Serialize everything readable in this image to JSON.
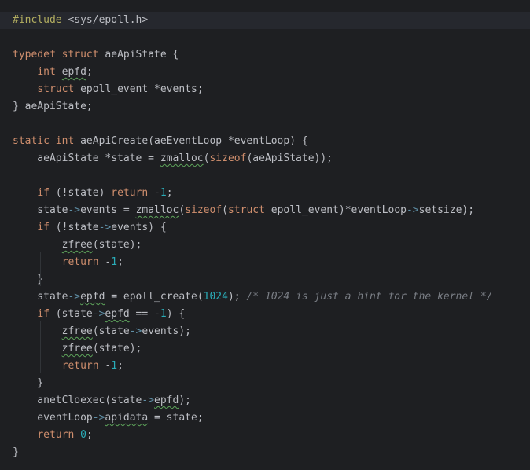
{
  "editor": {
    "current_line_index": 0,
    "lines": [
      [
        {
          "t": "#include",
          "c": "pp"
        },
        {
          "t": " <sys/epoll.h>",
          "c": ""
        }
      ],
      [],
      [
        {
          "t": "typedef",
          "c": "kw"
        },
        {
          "t": " ",
          "c": ""
        },
        {
          "t": "struct",
          "c": "kw"
        },
        {
          "t": " aeApiState {",
          "c": ""
        }
      ],
      [
        {
          "t": "    ",
          "c": ""
        },
        {
          "t": "int",
          "c": "kw"
        },
        {
          "t": " ",
          "c": ""
        },
        {
          "t": "epfd",
          "c": "squig"
        },
        {
          "t": ";",
          "c": ""
        }
      ],
      [
        {
          "t": "    ",
          "c": ""
        },
        {
          "t": "struct",
          "c": "kw"
        },
        {
          "t": " epoll_event *events;",
          "c": ""
        }
      ],
      [
        {
          "t": "} aeApiState;",
          "c": ""
        }
      ],
      [],
      [
        {
          "t": "static",
          "c": "kw"
        },
        {
          "t": " ",
          "c": ""
        },
        {
          "t": "int",
          "c": "kw"
        },
        {
          "t": " aeApiCreate(aeEventLoop *eventLoop) {",
          "c": ""
        }
      ],
      [
        {
          "t": "    aeApiState *state = ",
          "c": ""
        },
        {
          "t": "zmalloc",
          "c": "squig"
        },
        {
          "t": "(",
          "c": ""
        },
        {
          "t": "sizeof",
          "c": "kw"
        },
        {
          "t": "(aeApiState));",
          "c": ""
        }
      ],
      [],
      [
        {
          "t": "    ",
          "c": ""
        },
        {
          "t": "if",
          "c": "kw"
        },
        {
          "t": " (!state) ",
          "c": ""
        },
        {
          "t": "return",
          "c": "kw"
        },
        {
          "t": " -",
          "c": ""
        },
        {
          "t": "1",
          "c": "num"
        },
        {
          "t": ";",
          "c": ""
        }
      ],
      [
        {
          "t": "    state",
          "c": ""
        },
        {
          "t": "->",
          "c": "ar"
        },
        {
          "t": "events = ",
          "c": ""
        },
        {
          "t": "zmalloc",
          "c": "squig"
        },
        {
          "t": "(",
          "c": ""
        },
        {
          "t": "sizeof",
          "c": "kw"
        },
        {
          "t": "(",
          "c": ""
        },
        {
          "t": "struct",
          "c": "kw"
        },
        {
          "t": " epoll_event)*eventLoop",
          "c": ""
        },
        {
          "t": "->",
          "c": "ar"
        },
        {
          "t": "setsize);",
          "c": ""
        }
      ],
      [
        {
          "t": "    ",
          "c": ""
        },
        {
          "t": "if",
          "c": "kw"
        },
        {
          "t": " (!state",
          "c": ""
        },
        {
          "t": "->",
          "c": "ar"
        },
        {
          "t": "events) {",
          "c": ""
        }
      ],
      [
        {
          "t": "        ",
          "c": ""
        },
        {
          "t": "zfree",
          "c": "squig"
        },
        {
          "t": "(state);",
          "c": ""
        }
      ],
      [
        {
          "t": "        ",
          "c": ""
        },
        {
          "t": "return",
          "c": "kw"
        },
        {
          "t": " -",
          "c": ""
        },
        {
          "t": "1",
          "c": "num"
        },
        {
          "t": ";",
          "c": ""
        }
      ],
      [
        {
          "t": "    }",
          "c": ""
        }
      ],
      [
        {
          "t": "    state",
          "c": ""
        },
        {
          "t": "->",
          "c": "ar"
        },
        {
          "t": "epfd",
          "c": "squig"
        },
        {
          "t": " = epoll_create(",
          "c": ""
        },
        {
          "t": "1024",
          "c": "num"
        },
        {
          "t": "); ",
          "c": ""
        },
        {
          "t": "/* 1024 is just a hint for the kernel */",
          "c": "cm"
        }
      ],
      [
        {
          "t": "    ",
          "c": ""
        },
        {
          "t": "if",
          "c": "kw"
        },
        {
          "t": " (state",
          "c": ""
        },
        {
          "t": "->",
          "c": "ar"
        },
        {
          "t": "epfd",
          "c": "squig"
        },
        {
          "t": " == -",
          "c": ""
        },
        {
          "t": "1",
          "c": "num"
        },
        {
          "t": ") {",
          "c": ""
        }
      ],
      [
        {
          "t": "        ",
          "c": ""
        },
        {
          "t": "zfree",
          "c": "squig"
        },
        {
          "t": "(state",
          "c": ""
        },
        {
          "t": "->",
          "c": "ar"
        },
        {
          "t": "events);",
          "c": ""
        }
      ],
      [
        {
          "t": "        ",
          "c": ""
        },
        {
          "t": "zfree",
          "c": "squig"
        },
        {
          "t": "(state);",
          "c": ""
        }
      ],
      [
        {
          "t": "        ",
          "c": ""
        },
        {
          "t": "return",
          "c": "kw"
        },
        {
          "t": " -",
          "c": ""
        },
        {
          "t": "1",
          "c": "num"
        },
        {
          "t": ";",
          "c": ""
        }
      ],
      [
        {
          "t": "    }",
          "c": ""
        }
      ],
      [
        {
          "t": "    anetCloexec(state",
          "c": ""
        },
        {
          "t": "->",
          "c": "ar"
        },
        {
          "t": "epfd",
          "c": "squig"
        },
        {
          "t": ");",
          "c": ""
        }
      ],
      [
        {
          "t": "    eventLoop",
          "c": ""
        },
        {
          "t": "->",
          "c": "ar"
        },
        {
          "t": "apidata",
          "c": "squig"
        },
        {
          "t": " = state;",
          "c": ""
        }
      ],
      [
        {
          "t": "    ",
          "c": ""
        },
        {
          "t": "return",
          "c": "kw"
        },
        {
          "t": " ",
          "c": ""
        },
        {
          "t": "0",
          "c": "num"
        },
        {
          "t": ";",
          "c": ""
        }
      ],
      [
        {
          "t": "}",
          "c": ""
        }
      ]
    ]
  },
  "colors": {
    "background": "#1e1f22",
    "current_line": "#26282e",
    "text": "#bcbec4",
    "keyword": "#cf8e6d",
    "preprocessor": "#b3ae60",
    "number": "#2aacb8",
    "comment": "#7a7e85",
    "arrow": "#5f8fa6",
    "typo_underline": "#5ea55b"
  }
}
